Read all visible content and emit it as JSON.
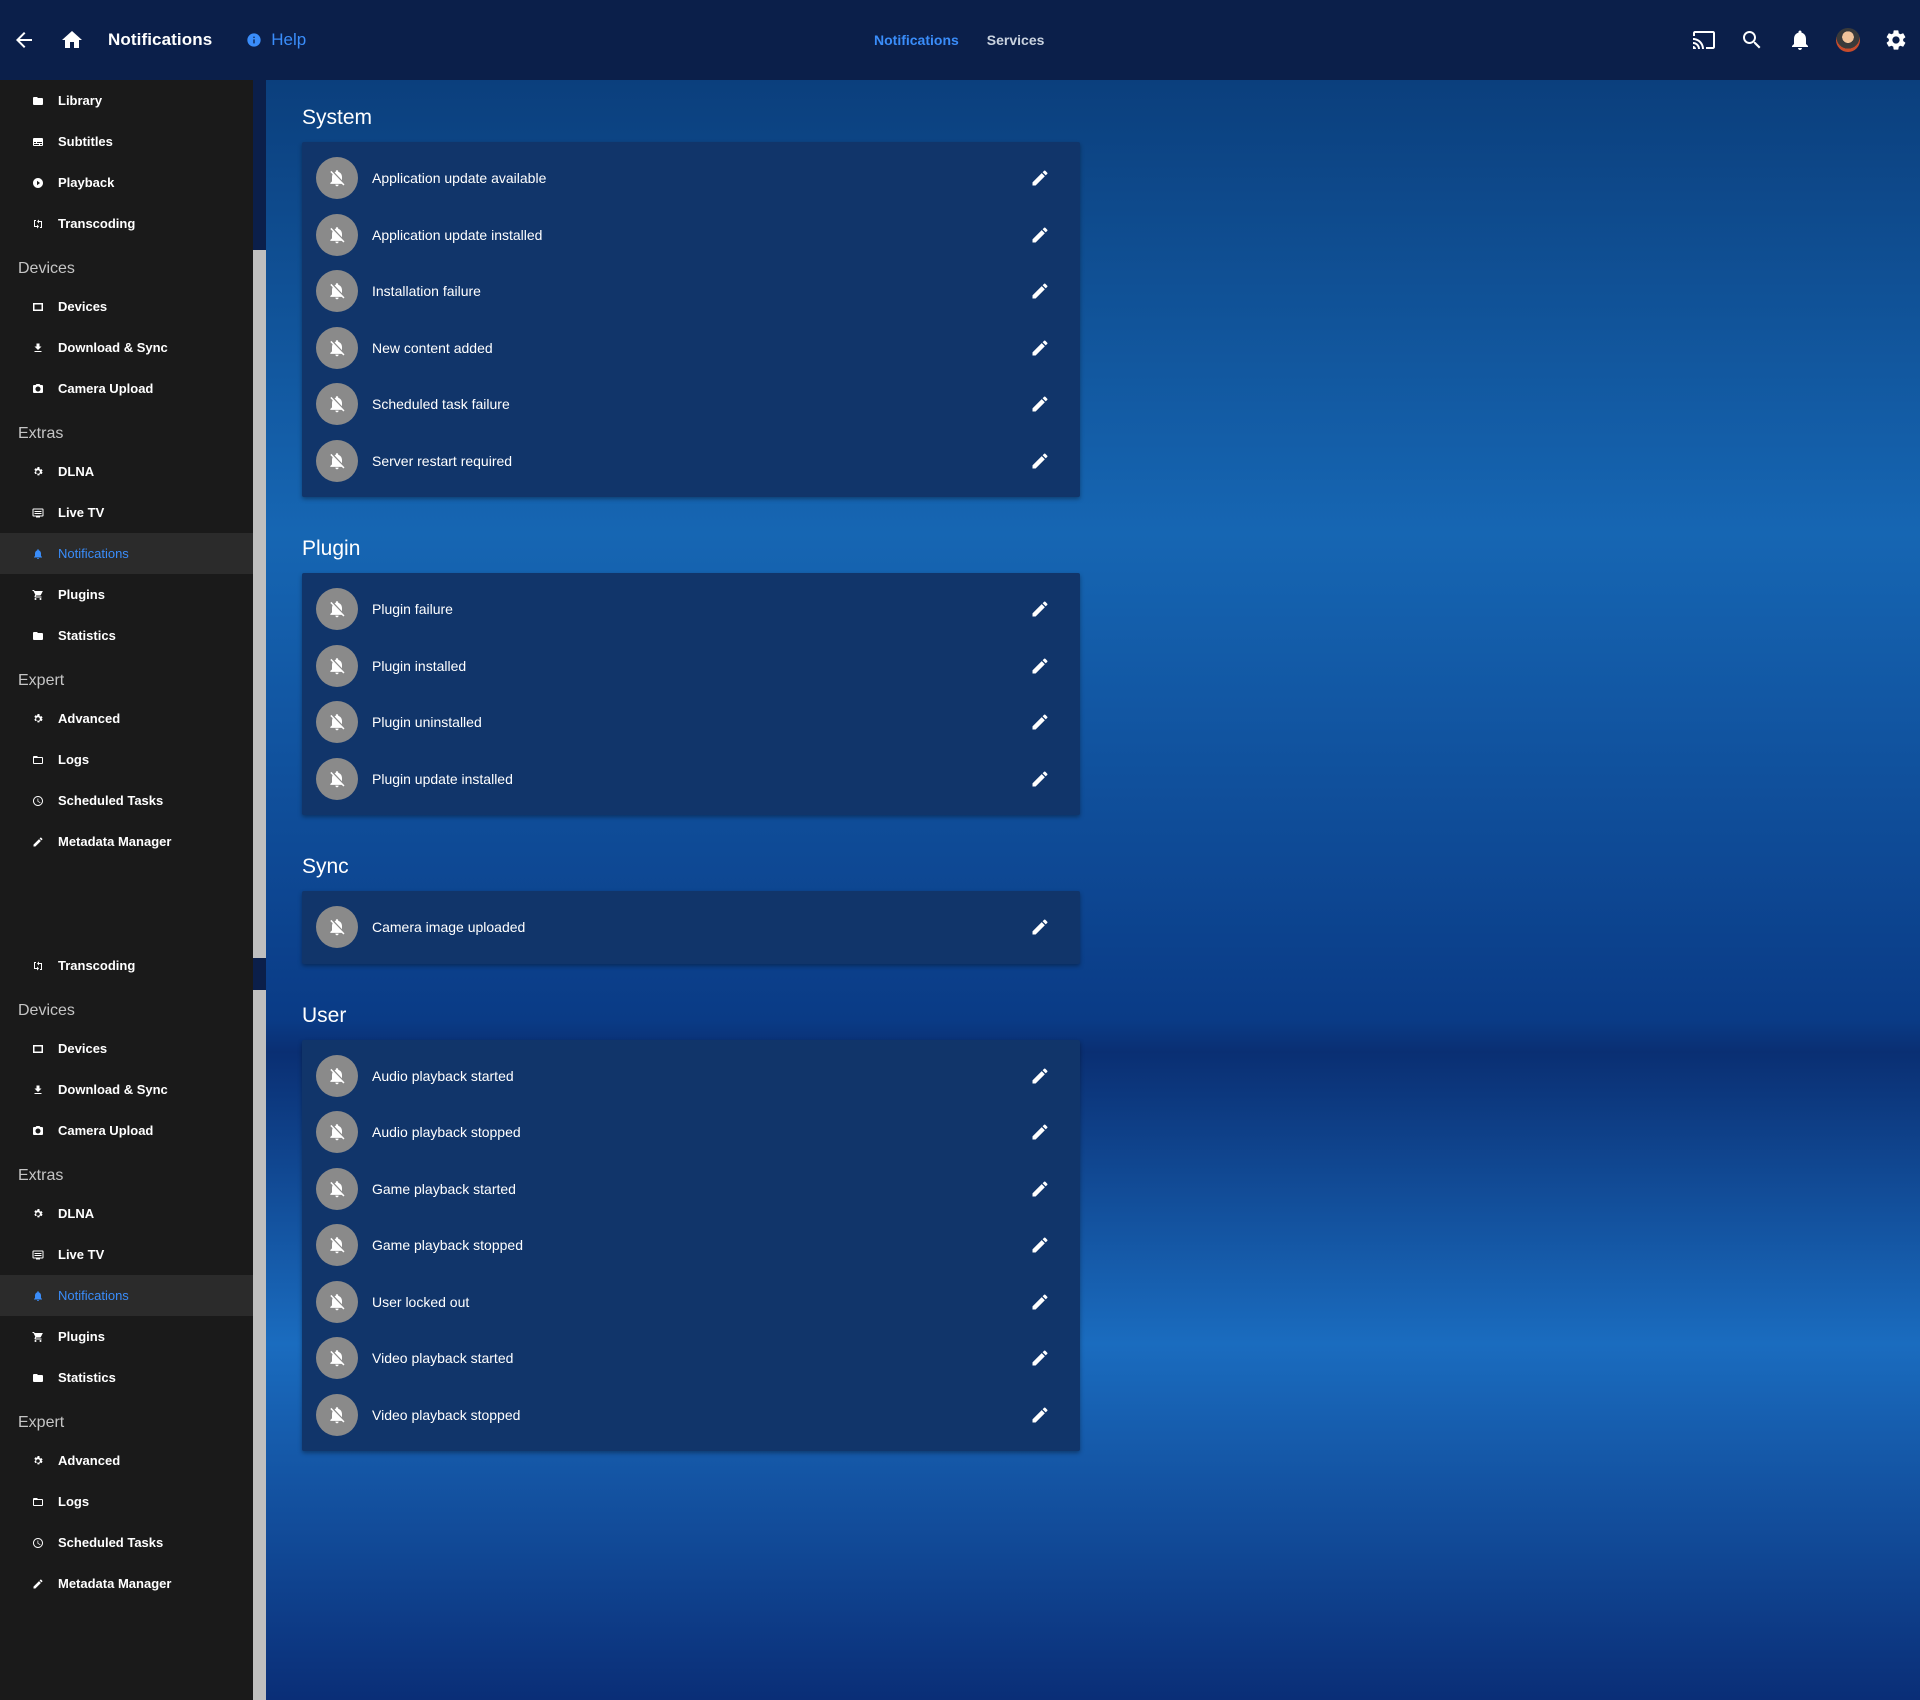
{
  "header": {
    "title": "Notifications",
    "help_label": "Help",
    "tabs": [
      {
        "label": "Notifications",
        "active": true
      },
      {
        "label": "Services",
        "active": false
      }
    ],
    "accent_color": "#3a8dfa"
  },
  "sidebar": {
    "groups_a": {
      "top_items": [
        {
          "label": "Library",
          "icon": "folder-icon"
        },
        {
          "label": "Subtitles",
          "icon": "subtitles-icon"
        },
        {
          "label": "Playback",
          "icon": "play-circle-icon"
        },
        {
          "label": "Transcoding",
          "icon": "transcode-icon"
        }
      ],
      "devices_header": "Devices",
      "devices": [
        {
          "label": "Devices",
          "icon": "devices-icon"
        },
        {
          "label": "Download & Sync",
          "icon": "download-icon"
        },
        {
          "label": "Camera Upload",
          "icon": "camera-icon"
        }
      ],
      "extras_header": "Extras",
      "extras": [
        {
          "label": "DLNA",
          "icon": "gear-icon"
        },
        {
          "label": "Live TV",
          "icon": "tv-icon"
        },
        {
          "label": "Notifications",
          "icon": "bell-icon",
          "active": true
        },
        {
          "label": "Plugins",
          "icon": "cart-icon"
        },
        {
          "label": "Statistics",
          "icon": "folder-icon"
        }
      ],
      "expert_header": "Expert",
      "expert": [
        {
          "label": "Advanced",
          "icon": "gear-icon"
        },
        {
          "label": "Logs",
          "icon": "folder-outline-icon"
        },
        {
          "label": "Scheduled Tasks",
          "icon": "clock-icon"
        },
        {
          "label": "Metadata Manager",
          "icon": "pencil-icon"
        }
      ]
    },
    "groups_b": {
      "top_items": [
        {
          "label": "Transcoding",
          "icon": "transcode-icon"
        }
      ],
      "devices_header": "Devices",
      "devices": [
        {
          "label": "Devices",
          "icon": "devices-icon"
        },
        {
          "label": "Download & Sync",
          "icon": "download-icon"
        },
        {
          "label": "Camera Upload",
          "icon": "camera-icon"
        }
      ],
      "extras_header": "Extras",
      "extras": [
        {
          "label": "DLNA",
          "icon": "gear-icon"
        },
        {
          "label": "Live TV",
          "icon": "tv-icon"
        },
        {
          "label": "Notifications",
          "icon": "bell-icon",
          "active": true
        },
        {
          "label": "Plugins",
          "icon": "cart-icon"
        },
        {
          "label": "Statistics",
          "icon": "folder-icon"
        }
      ],
      "expert_header": "Expert",
      "expert": [
        {
          "label": "Advanced",
          "icon": "gear-icon"
        },
        {
          "label": "Logs",
          "icon": "folder-outline-icon"
        },
        {
          "label": "Scheduled Tasks",
          "icon": "clock-icon"
        },
        {
          "label": "Metadata Manager",
          "icon": "pencil-icon"
        }
      ]
    }
  },
  "sections": [
    {
      "title": "System",
      "items": [
        "Application update available",
        "Application update installed",
        "Installation failure",
        "New content added",
        "Scheduled task failure",
        "Server restart required"
      ]
    },
    {
      "title": "Plugin",
      "items": [
        "Plugin failure",
        "Plugin installed",
        "Plugin uninstalled",
        "Plugin update installed"
      ]
    },
    {
      "title": "Sync",
      "items": [
        "Camera image uploaded"
      ]
    },
    {
      "title": "User",
      "items": [
        "Audio playback started",
        "Audio playback stopped",
        "Game playback started",
        "Game playback stopped",
        "User locked out",
        "Video playback started",
        "Video playback stopped"
      ]
    }
  ]
}
